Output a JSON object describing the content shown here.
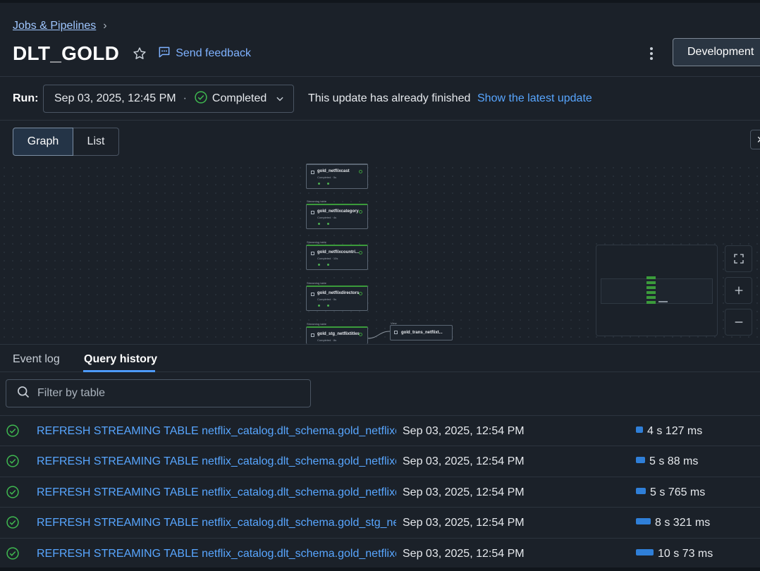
{
  "breadcrumb": {
    "parent": "Jobs & Pipelines"
  },
  "header": {
    "title": "DLT_GOLD",
    "feedback_label": "Send feedback",
    "mode_button": "Development"
  },
  "run": {
    "label": "Run:",
    "date": "Sep 03, 2025, 12:45 PM",
    "separator": "·",
    "status": "Completed",
    "message": "This update has already finished",
    "latest_link": "Show the latest update"
  },
  "view_toggle": {
    "graph": "Graph",
    "list": "List",
    "active": "Graph"
  },
  "graph": {
    "nodes": [
      {
        "type_label": "",
        "name": "gold_netflixcast",
        "status": "Completed · 5s"
      },
      {
        "type_label": "Streaming table",
        "name": "gold_netflixcategory",
        "status": "Completed · 4s"
      },
      {
        "type_label": "Streaming table",
        "name": "gold_netflixcountri...",
        "status": "Completed · 10s"
      },
      {
        "type_label": "Streaming table",
        "name": "gold_netflixdirectors",
        "status": "Completed · 5s"
      },
      {
        "type_label": "Streaming table",
        "name": "gold_stg_netflixtitles",
        "status": "Completed · 8s"
      }
    ],
    "view_node": {
      "type_label": "View",
      "name": "gold_trans_netflixt..."
    }
  },
  "bottom_tabs": {
    "event_log": "Event log",
    "query_history": "Query history",
    "active": "Query history"
  },
  "filter": {
    "placeholder": "Filter by table"
  },
  "queries": [
    {
      "sql": "REFRESH STREAMING TABLE netflix_catalog.dlt_schema.gold_netflixcategory",
      "time": "Sep 03, 2025, 12:54 PM",
      "duration": "4 s 127 ms",
      "duration_ms": 4127
    },
    {
      "sql": "REFRESH STREAMING TABLE netflix_catalog.dlt_schema.gold_netflixcast",
      "time": "Sep 03, 2025, 12:54 PM",
      "duration": "5 s 88 ms",
      "duration_ms": 5088
    },
    {
      "sql": "REFRESH STREAMING TABLE netflix_catalog.dlt_schema.gold_netflixdirectors",
      "time": "Sep 03, 2025, 12:54 PM",
      "duration": "5 s 765 ms",
      "duration_ms": 5765
    },
    {
      "sql": "REFRESH STREAMING TABLE netflix_catalog.dlt_schema.gold_stg_netflixtitles",
      "time": "Sep 03, 2025, 12:54 PM",
      "duration": "8 s 321 ms",
      "duration_ms": 8321
    },
    {
      "sql": "REFRESH STREAMING TABLE netflix_catalog.dlt_schema.gold_netflixcountries",
      "time": "Sep 03, 2025, 12:54 PM",
      "duration": "10 s 73 ms",
      "duration_ms": 10073
    }
  ],
  "colors": {
    "accent": "#58a6ff",
    "success": "#3b9b3b",
    "bar": "#2f7fd8",
    "background": "#1b2129"
  }
}
